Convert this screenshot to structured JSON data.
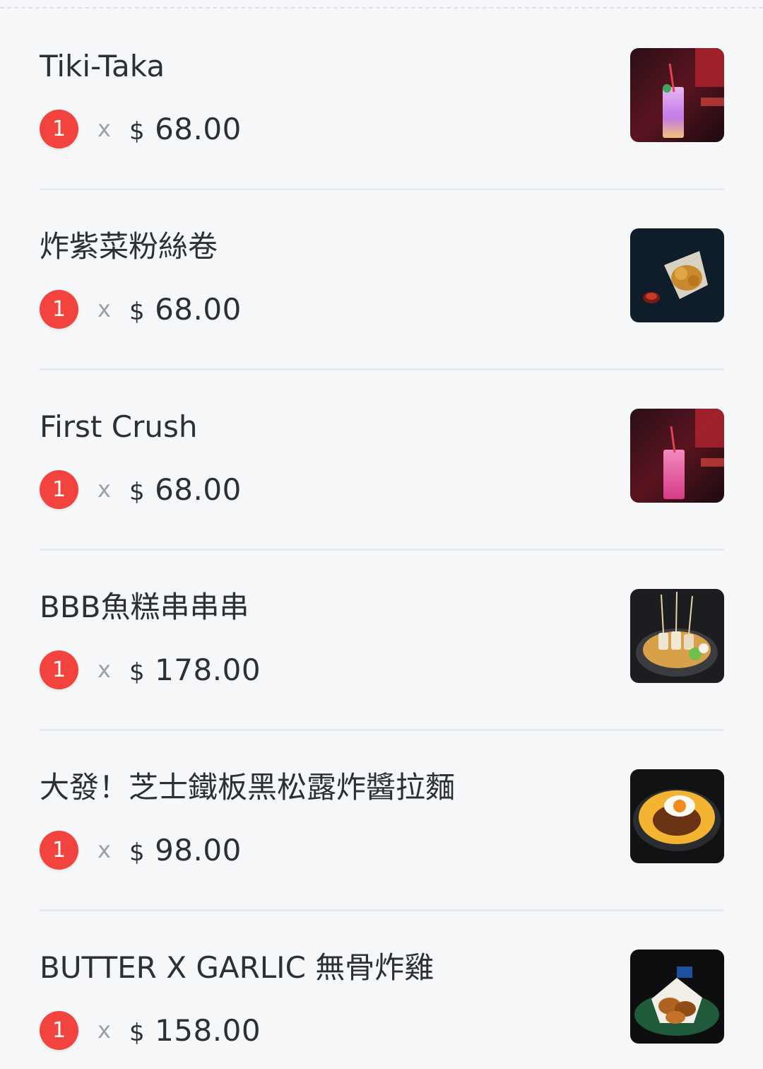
{
  "currency_symbol": "$",
  "times_symbol": "x",
  "badge_color": "#f2433f",
  "items": [
    {
      "name": "Tiki-Taka",
      "quantity": "1",
      "price": "68.00",
      "image_icon": "cocktail-glass-icon"
    },
    {
      "name": "炸紫菜粉絲卷",
      "quantity": "1",
      "price": "68.00",
      "image_icon": "fried-seaweed-roll-icon"
    },
    {
      "name": "First Crush",
      "quantity": "1",
      "price": "68.00",
      "image_icon": "cocktail-glass-icon"
    },
    {
      "name": "BBB魚糕串串串",
      "quantity": "1",
      "price": "178.00",
      "image_icon": "fish-cake-skewers-icon"
    },
    {
      "name": "大發！芝士鐵板黑松露炸醬拉麵",
      "quantity": "1",
      "price": "98.00",
      "image_icon": "cheese-ramen-egg-icon"
    },
    {
      "name": "BUTTER X GARLIC 無骨炸雞",
      "quantity": "1",
      "price": "158.00",
      "image_icon": "fried-chicken-basket-icon"
    }
  ]
}
